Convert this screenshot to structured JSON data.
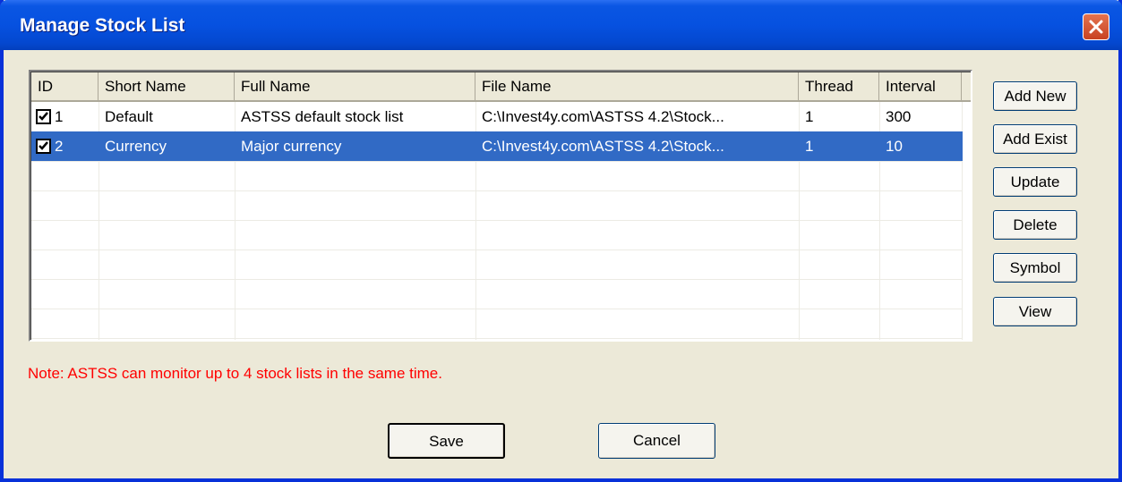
{
  "window": {
    "title": "Manage Stock List"
  },
  "table": {
    "columns": [
      "ID",
      "Short Name",
      "Full Name",
      "File Name",
      "Thread",
      "Interval"
    ],
    "rows": [
      {
        "id": "1",
        "checked": true,
        "short_name": "Default",
        "full_name": "ASTSS default stock list",
        "file_name": "C:\\Invest4y.com\\ASTSS 4.2\\Stock...",
        "thread": "1",
        "interval": "300",
        "selected": false
      },
      {
        "id": "2",
        "checked": true,
        "short_name": "Currency",
        "full_name": "Major currency",
        "file_name": "C:\\Invest4y.com\\ASTSS 4.2\\Stock...",
        "thread": "1",
        "interval": "10",
        "selected": true
      }
    ]
  },
  "side_buttons": {
    "add_new": "Add New",
    "add_exist": "Add Exist",
    "update": "Update",
    "delete": "Delete",
    "symbol": "Symbol",
    "view": "View"
  },
  "note": "Note: ASTSS can monitor up to 4 stock lists in the same time.",
  "footer": {
    "save": "Save",
    "cancel": "Cancel"
  },
  "colors": {
    "selection": "#316ac5",
    "note": "#ff0000",
    "title_bar": "#0651e0"
  }
}
